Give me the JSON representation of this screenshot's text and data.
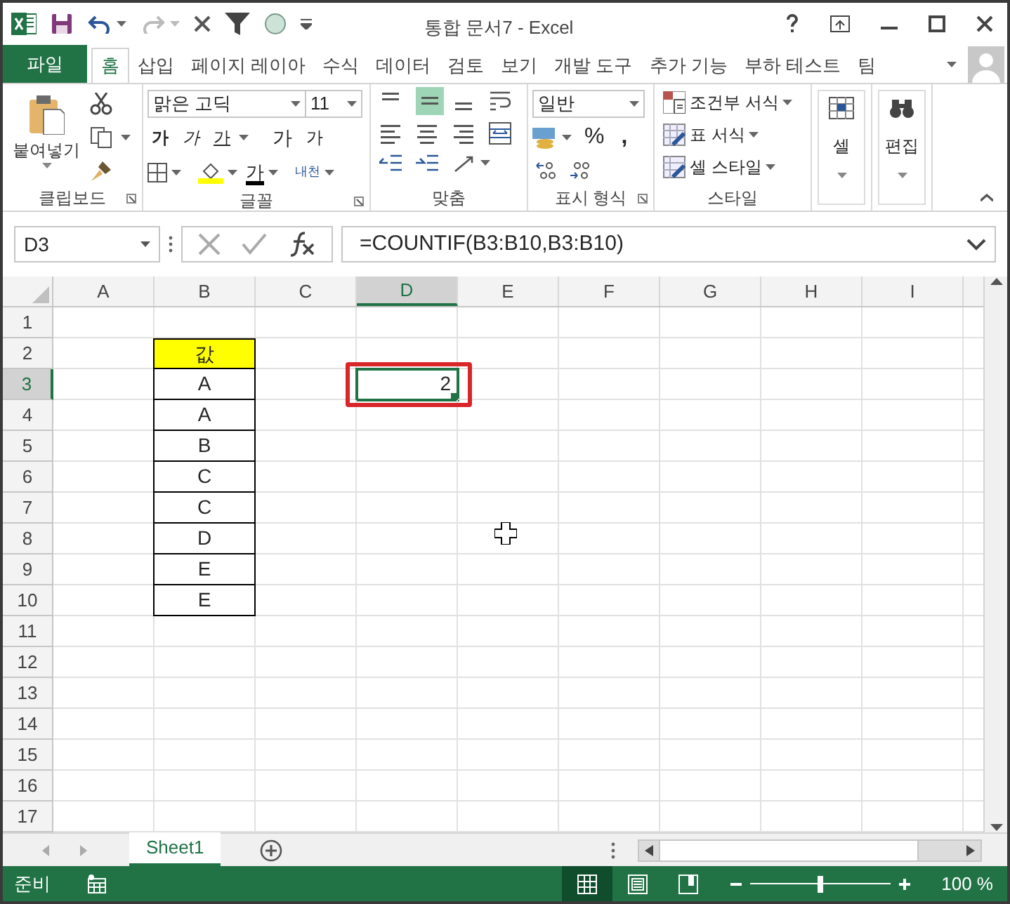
{
  "window": {
    "title": "통합 문서7 - Excel"
  },
  "ribbon_tabs": [
    {
      "label": "파일",
      "kind": "file",
      "selected": false
    },
    {
      "label": "홈",
      "kind": "tab",
      "selected": true
    },
    {
      "label": "삽입",
      "kind": "tab",
      "selected": false
    },
    {
      "label": "페이지 레이아",
      "kind": "tab",
      "selected": false
    },
    {
      "label": "수식",
      "kind": "tab",
      "selected": false
    },
    {
      "label": "데이터",
      "kind": "tab",
      "selected": false
    },
    {
      "label": "검토",
      "kind": "tab",
      "selected": false
    },
    {
      "label": "보기",
      "kind": "tab",
      "selected": false
    },
    {
      "label": "개발 도구",
      "kind": "tab",
      "selected": false
    },
    {
      "label": "추가 기능",
      "kind": "tab",
      "selected": false
    },
    {
      "label": "부하 테스트",
      "kind": "tab",
      "selected": false
    },
    {
      "label": "팀",
      "kind": "tab",
      "selected": false
    }
  ],
  "ribbon": {
    "clipboard": {
      "label": "클립보드",
      "paste": "붙여넣기"
    },
    "font": {
      "label": "글꼴",
      "font_name": "맑은 고딕",
      "font_size": "11",
      "bold": "가",
      "italic": "가",
      "underline": "가",
      "grow": "가",
      "shrink": "가",
      "font_color": "가",
      "phonetic": "내천"
    },
    "alignment": {
      "label": "맞춤"
    },
    "number": {
      "label": "표시 형식",
      "format": "일반",
      "percent": "%",
      "comma": ","
    },
    "styles": {
      "label": "스타일",
      "items": [
        "조건부 서식",
        "표 서식",
        "셀 스타일"
      ]
    },
    "cells": {
      "label": "셀"
    },
    "editing": {
      "label": "편집"
    }
  },
  "formula_bar": {
    "name_box": "D3",
    "formula": "=COUNTIF(B3:B10,B3:B10)"
  },
  "columns": [
    {
      "label": "A",
      "selected": false
    },
    {
      "label": "B",
      "selected": false
    },
    {
      "label": "C",
      "selected": false
    },
    {
      "label": "D",
      "selected": true
    },
    {
      "label": "E",
      "selected": false
    },
    {
      "label": "F",
      "selected": false
    },
    {
      "label": "G",
      "selected": false
    },
    {
      "label": "H",
      "selected": false
    },
    {
      "label": "I",
      "selected": false
    }
  ],
  "rows": [
    {
      "label": "1",
      "selected": false,
      "cells": {}
    },
    {
      "label": "2",
      "selected": false,
      "cells": {
        "B": {
          "value": "값",
          "kind": "header"
        }
      }
    },
    {
      "label": "3",
      "selected": true,
      "cells": {
        "B": {
          "value": "A",
          "kind": "data"
        },
        "D": {
          "value": "2",
          "kind": "number",
          "selected": true,
          "highlighted": true
        }
      }
    },
    {
      "label": "4",
      "selected": false,
      "cells": {
        "B": {
          "value": "A",
          "kind": "data"
        }
      }
    },
    {
      "label": "5",
      "selected": false,
      "cells": {
        "B": {
          "value": "B",
          "kind": "data"
        }
      }
    },
    {
      "label": "6",
      "selected": false,
      "cells": {
        "B": {
          "value": "C",
          "kind": "data"
        }
      }
    },
    {
      "label": "7",
      "selected": false,
      "cells": {
        "B": {
          "value": "C",
          "kind": "data"
        }
      }
    },
    {
      "label": "8",
      "selected": false,
      "cells": {
        "B": {
          "value": "D",
          "kind": "data"
        }
      }
    },
    {
      "label": "9",
      "selected": false,
      "cells": {
        "B": {
          "value": "E",
          "kind": "data"
        }
      }
    },
    {
      "label": "10",
      "selected": false,
      "cells": {
        "B": {
          "value": "E",
          "kind": "data"
        }
      }
    },
    {
      "label": "11",
      "selected": false,
      "cells": {}
    },
    {
      "label": "12",
      "selected": false,
      "cells": {}
    },
    {
      "label": "13",
      "selected": false,
      "cells": {}
    },
    {
      "label": "14",
      "selected": false,
      "cells": {}
    },
    {
      "label": "15",
      "selected": false,
      "cells": {}
    },
    {
      "label": "16",
      "selected": false,
      "cells": {}
    },
    {
      "label": "17",
      "selected": false,
      "cells": {}
    }
  ],
  "sheet_tabs": [
    {
      "label": "Sheet1",
      "selected": true
    }
  ],
  "status_bar": {
    "status": "준비",
    "views": [
      {
        "kind": "normal",
        "selected": true
      },
      {
        "kind": "page_layout",
        "selected": false
      },
      {
        "kind": "page_break",
        "selected": false
      }
    ],
    "zoom": {
      "level": 0.5,
      "reading": "100 %"
    }
  }
}
